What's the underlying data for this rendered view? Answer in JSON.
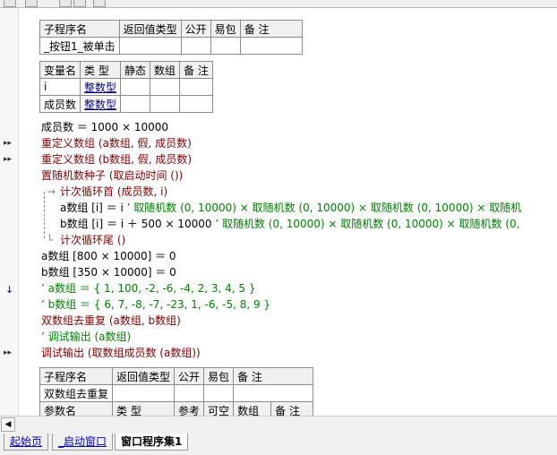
{
  "header_table": {
    "columns": [
      "子程序名",
      "返回值类型",
      "公开",
      "易包",
      "备 注"
    ],
    "row": [
      "_按钮1_被单击",
      "",
      "",
      "",
      ""
    ]
  },
  "var_table": {
    "columns": [
      "变量名",
      "类 型",
      "静态",
      "数组",
      "备 注"
    ],
    "rows": [
      [
        "i",
        "整数型",
        "",
        "",
        ""
      ],
      [
        "成员数",
        "整数型",
        "",
        "",
        ""
      ]
    ]
  },
  "code": {
    "l1": "成员数 ＝ 1000 × 10000",
    "l2": "重定义数组 (a数组, 假, 成员数)",
    "l3": "重定义数组 (b数组, 假, 成员数)",
    "l4": "置随机数种子 (取启动时间 ())",
    "l5": "计次循环首 (成员数, i)",
    "l6a": "a数组 [i] ＝ i",
    "l6b": "’ 取随机数 (0, 10000) × 取随机数 (0, 10000) × 取随机数 (0, 10000) × 取随机",
    "l7a": "b数组 [i] ＝ i ＋ 500 × 10000",
    "l7b": "’ 取随机数 (0, 10000) × 取随机数 (0, 10000) × 取随机数 (0,",
    "l8": "计次循环尾 ()",
    "l9": "a数组 [800 × 10000] ＝ 0",
    "l10": "b数组 [350 × 10000] ＝ 0",
    "l11": "’ a数组 ＝ { 1, 100, -2, -6, -4, 2, 3, 4, 5 }",
    "l12": "’ b数组 ＝ { 6, 7, -8, -7, -23, 1, -6, -5, 8, 9 }",
    "l13": "双数组去重复 (a数组, b数组)",
    "l14": "’ 调试输出 (a数组)",
    "l15": "调试输出 (取数组成员数 (a数组))"
  },
  "sub_table2": {
    "columns": [
      "子程序名",
      "返回值类型",
      "公开",
      "易包",
      "备 注"
    ],
    "row": [
      "双数组去重复",
      "",
      "",
      "",
      ""
    ],
    "param_columns": [
      "参数名",
      "类 型",
      "参考",
      "可空",
      "数组",
      "备 注"
    ]
  },
  "tabs": [
    "起始页",
    "_启动窗口",
    "窗口程序集1"
  ],
  "colors": {
    "command": "#800000",
    "comment": "#008000",
    "type_link": "#000080"
  }
}
